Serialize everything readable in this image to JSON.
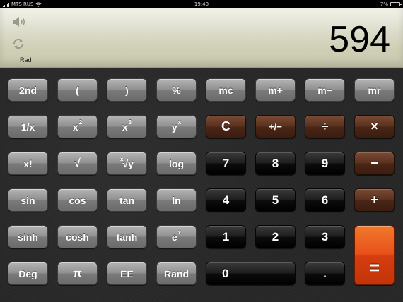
{
  "status_bar": {
    "carrier": "MTS RUS",
    "time": "19:40",
    "battery": "7%",
    "battery_level": 0.07
  },
  "display": {
    "mode": "Rad",
    "value": "594",
    "speaker_icon": "speaker-icon",
    "refresh_icon": "refresh-icon"
  },
  "keys": {
    "row1": [
      "2nd",
      "(",
      ")",
      "%",
      "mc",
      "m+",
      "m−",
      "mr"
    ],
    "row2": {
      "inverse": "1/x",
      "square_base": "x",
      "square_exp": "2",
      "cube_base": "x",
      "cube_exp": "3",
      "power_base": "y",
      "power_exp": "x",
      "clear": "C",
      "plus_minus": "+/−",
      "divide": "÷",
      "multiply": "×"
    },
    "row3": {
      "factorial": "x!",
      "sqrt": "√",
      "root_pre": "x",
      "root_sym": "√y",
      "log": "log",
      "d7": "7",
      "d8": "8",
      "d9": "9",
      "minus": "−"
    },
    "row4": [
      "sin",
      "cos",
      "tan",
      "ln",
      "4",
      "5",
      "6",
      "+"
    ],
    "row5": {
      "sinh": "sinh",
      "cosh": "cosh",
      "tanh": "tanh",
      "exp_base": "e",
      "exp_exp": "x",
      "d1": "1",
      "d2": "2",
      "d3": "3",
      "equals": "="
    },
    "row6": [
      "Deg",
      "π",
      "EE",
      "Rand",
      "0",
      "."
    ]
  },
  "colors": {
    "gray_key": "#8e8e8e",
    "black_key": "#111111",
    "brown_key": "#5a321f",
    "orange_key": "#e8501a",
    "display_bg": "#dcdccb"
  }
}
